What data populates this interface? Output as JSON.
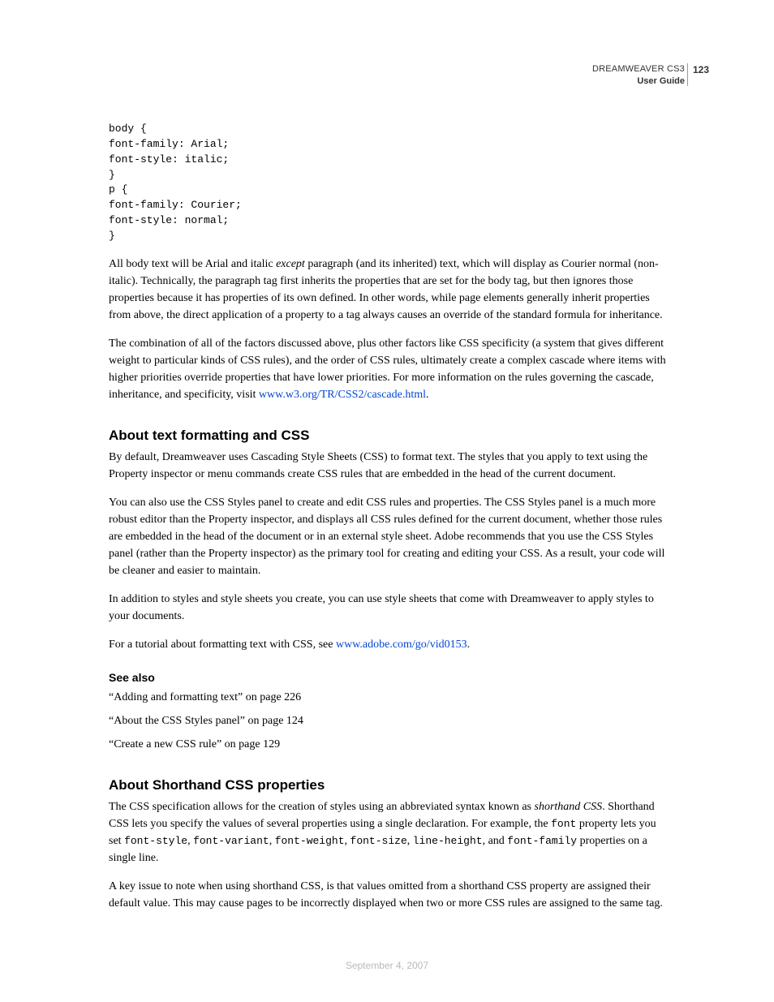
{
  "header": {
    "product": "DREAMWEAVER CS3",
    "doc": "User Guide",
    "page": "123"
  },
  "code_block": "body {\nfont-family: Arial;\nfont-style: italic;\n}\np {\nfont-family: Courier;\nfont-style: normal;\n}",
  "para_inherit_1": "All body text will be Arial and italic ",
  "para_inherit_em": "except",
  "para_inherit_2": " paragraph (and its inherited) text, which will display as Courier normal (non-italic). Technically, the paragraph tag first inherits the properties that are set for the body tag, but then ignores those properties because it has properties of its own defined. In other words, while page elements generally inherit properties from above, the direct application of a property to a tag always causes an override of the standard formula for inheritance.",
  "para_cascade_1": "The combination of all of the factors discussed above, plus other factors like CSS specificity (a system that gives different weight to particular kinds of CSS rules), and the order of CSS rules, ultimately create a complex cascade where items with higher priorities override properties that have lower priorities. For more information on the rules governing the cascade, inheritance, and specificity, visit ",
  "para_cascade_link": "www.w3.org/TR/CSS2/cascade.html",
  "para_cascade_2": ".",
  "sec1_title": "About text formatting and CSS",
  "sec1_p1": "By default, Dreamweaver uses Cascading Style Sheets (CSS) to format text. The styles that you apply to text using the Property inspector or menu commands create CSS rules that are embedded in the head of the current document.",
  "sec1_p2": "You can also use the CSS Styles panel to create and edit CSS rules and properties. The CSS Styles panel is a much more robust editor than the Property inspector, and displays all CSS rules defined for the current document, whether those rules are embedded in the head of the document or in an external style sheet. Adobe recommends that you use the CSS Styles panel (rather than the Property inspector) as the primary tool for creating and editing your CSS. As a result, your code will be cleaner and easier to maintain.",
  "sec1_p3": "In addition to styles and style sheets you create, you can use style sheets that come with Dreamweaver to apply styles to your documents.",
  "sec1_p4a": "For a tutorial about formatting text with CSS, see ",
  "sec1_p4_link": "www.adobe.com/go/vid0153",
  "sec1_p4b": ".",
  "seealso_title": "See also",
  "seealso_items": [
    "“Adding and formatting text” on page 226",
    "“About the CSS Styles panel” on page 124",
    "“Create a new CSS rule” on page 129"
  ],
  "sec2_title": "About Shorthand CSS properties",
  "sec2_p1a": "The CSS specification allows for the creation of styles using an abbreviated syntax known as ",
  "sec2_p1em": "shorthand CSS",
  "sec2_p1b": ". Shorthand CSS lets you specify the values of several properties using a single declaration. For example, the ",
  "sec2_p1c1": "font",
  "sec2_p1c2": " property lets you set ",
  "sec2_code_fs": "font-style",
  "sec2_code_fv": "font-variant",
  "sec2_code_fw": "font-weight",
  "sec2_code_fsz": "font-size",
  "sec2_code_lh": "line-height",
  "sec2_and": ", and ",
  "sec2_code_ff": "font-family",
  "sec2_p1d": " properties on a single line.",
  "sec2_p2": "A key issue to note when using shorthand CSS, is that values omitted from a shorthand CSS property are assigned their default value. This may cause pages to be incorrectly displayed when two or more CSS rules are assigned to the same tag.",
  "footer_date": "September 4, 2007",
  "comma": ", "
}
